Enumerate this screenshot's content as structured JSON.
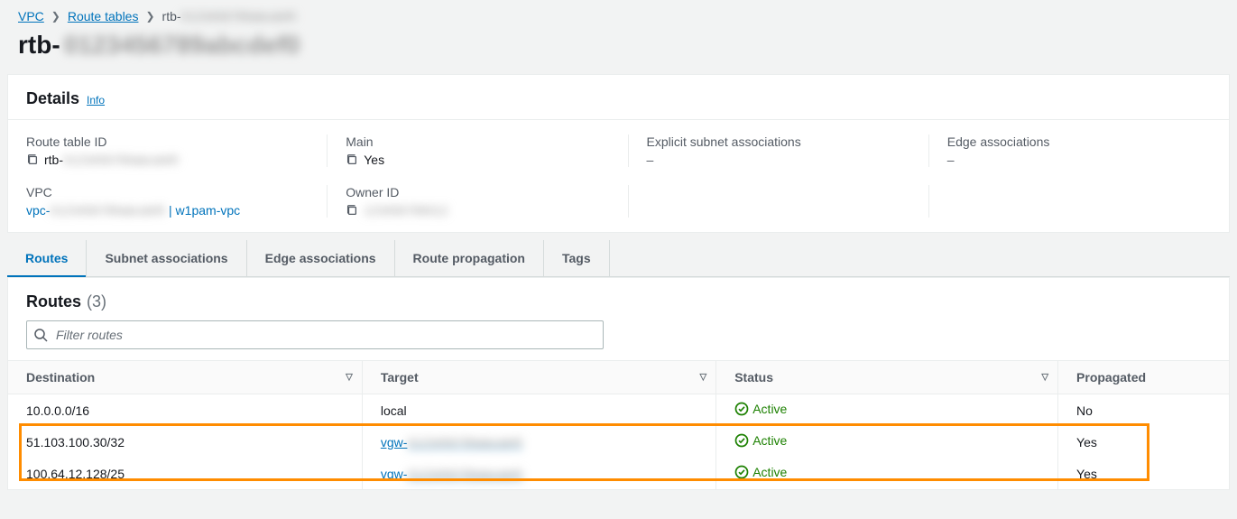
{
  "breadcrumb": {
    "vpc": "VPC",
    "route_tables": "Route tables",
    "current": "rtb-",
    "current_redacted": "0123456789abcdef0"
  },
  "page_title": {
    "prefix": "rtb-",
    "redacted": "0123456789abcdef0"
  },
  "details": {
    "heading": "Details",
    "info": "Info",
    "fields": {
      "route_table_id": {
        "label": "Route table ID",
        "value_prefix": "rtb-",
        "value_redacted": "0123456789abcdef0"
      },
      "main": {
        "label": "Main",
        "value": "Yes"
      },
      "explicit_subnet": {
        "label": "Explicit subnet associations",
        "value": "–"
      },
      "edge_assoc": {
        "label": "Edge associations",
        "value": "–"
      },
      "vpc": {
        "label": "VPC",
        "value_prefix": "vpc-",
        "value_redacted": "0123456789abcdef0",
        "suffix": " | w1pam-vpc"
      },
      "owner_id": {
        "label": "Owner ID",
        "value_redacted": "123456789012"
      }
    }
  },
  "tabs": [
    {
      "label": "Routes",
      "active": true
    },
    {
      "label": "Subnet associations",
      "active": false
    },
    {
      "label": "Edge associations",
      "active": false
    },
    {
      "label": "Route propagation",
      "active": false
    },
    {
      "label": "Tags",
      "active": false
    }
  ],
  "routes": {
    "heading": "Routes",
    "count": "(3)",
    "filter_placeholder": "Filter routes",
    "columns": {
      "destination": "Destination",
      "target": "Target",
      "status": "Status",
      "propagated": "Propagated"
    },
    "rows": [
      {
        "destination": "10.0.0.0/16",
        "target": "local",
        "target_link": false,
        "status": "Active",
        "propagated": "No"
      },
      {
        "destination": "51.103.100.30/32",
        "target": "vgw-",
        "target_redacted": "0123456789abcdef0",
        "target_link": true,
        "status": "Active",
        "propagated": "Yes"
      },
      {
        "destination": "100.64.12.128/25",
        "target": "vgw-",
        "target_redacted": "0123456789abcdef0",
        "target_link": true,
        "status": "Active",
        "propagated": "Yes"
      }
    ]
  }
}
